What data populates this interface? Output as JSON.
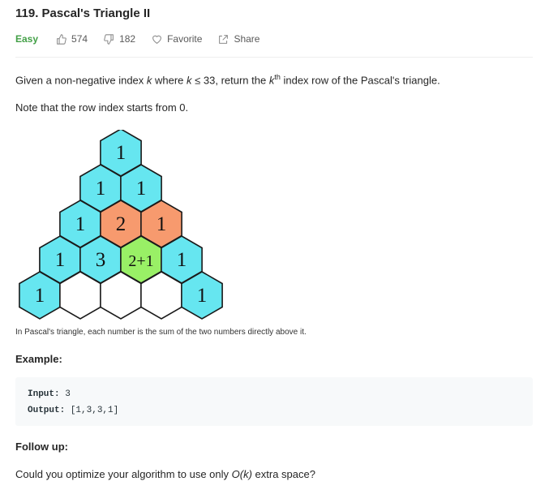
{
  "problem": {
    "title": "119. Pascal's Triangle II",
    "difficulty": "Easy",
    "likes": "574",
    "dislikes": "182",
    "favorite_label": "Favorite",
    "share_label": "Share",
    "colors": {
      "easy": "#43a047",
      "hex_cyan": "#66e6f0",
      "hex_orange": "#f79a6e",
      "hex_green": "#99f066"
    }
  },
  "description": {
    "line1_a": "Given a non-negative index ",
    "line1_k1": "k",
    "line1_b": " where ",
    "line1_k2": "k",
    "line1_c": " ≤ 33, return the ",
    "line1_k3": "k",
    "line1_sup": "th",
    "line1_d": " index row of the Pascal's triangle.",
    "line2": "Note that the row index starts from 0."
  },
  "figure": {
    "rows": [
      [
        "1"
      ],
      [
        "1",
        "1"
      ],
      [
        "1",
        "2",
        "1"
      ],
      [
        "1",
        "3",
        "2+1",
        "1"
      ],
      [
        "1",
        "",
        "",
        "",
        "1"
      ]
    ],
    "caption": "In Pascal's triangle, each number is the sum of the two numbers directly above it."
  },
  "example": {
    "heading": "Example:",
    "input_label": "Input:",
    "input_value": "3",
    "output_label": "Output:",
    "output_value": "[1,3,3,1]"
  },
  "follow_up": {
    "heading": "Follow up:",
    "text_a": "Could you optimize your algorithm to use only ",
    "text_o": "O(",
    "text_k": "k",
    "text_close": ")",
    "text_b": " extra space?"
  }
}
